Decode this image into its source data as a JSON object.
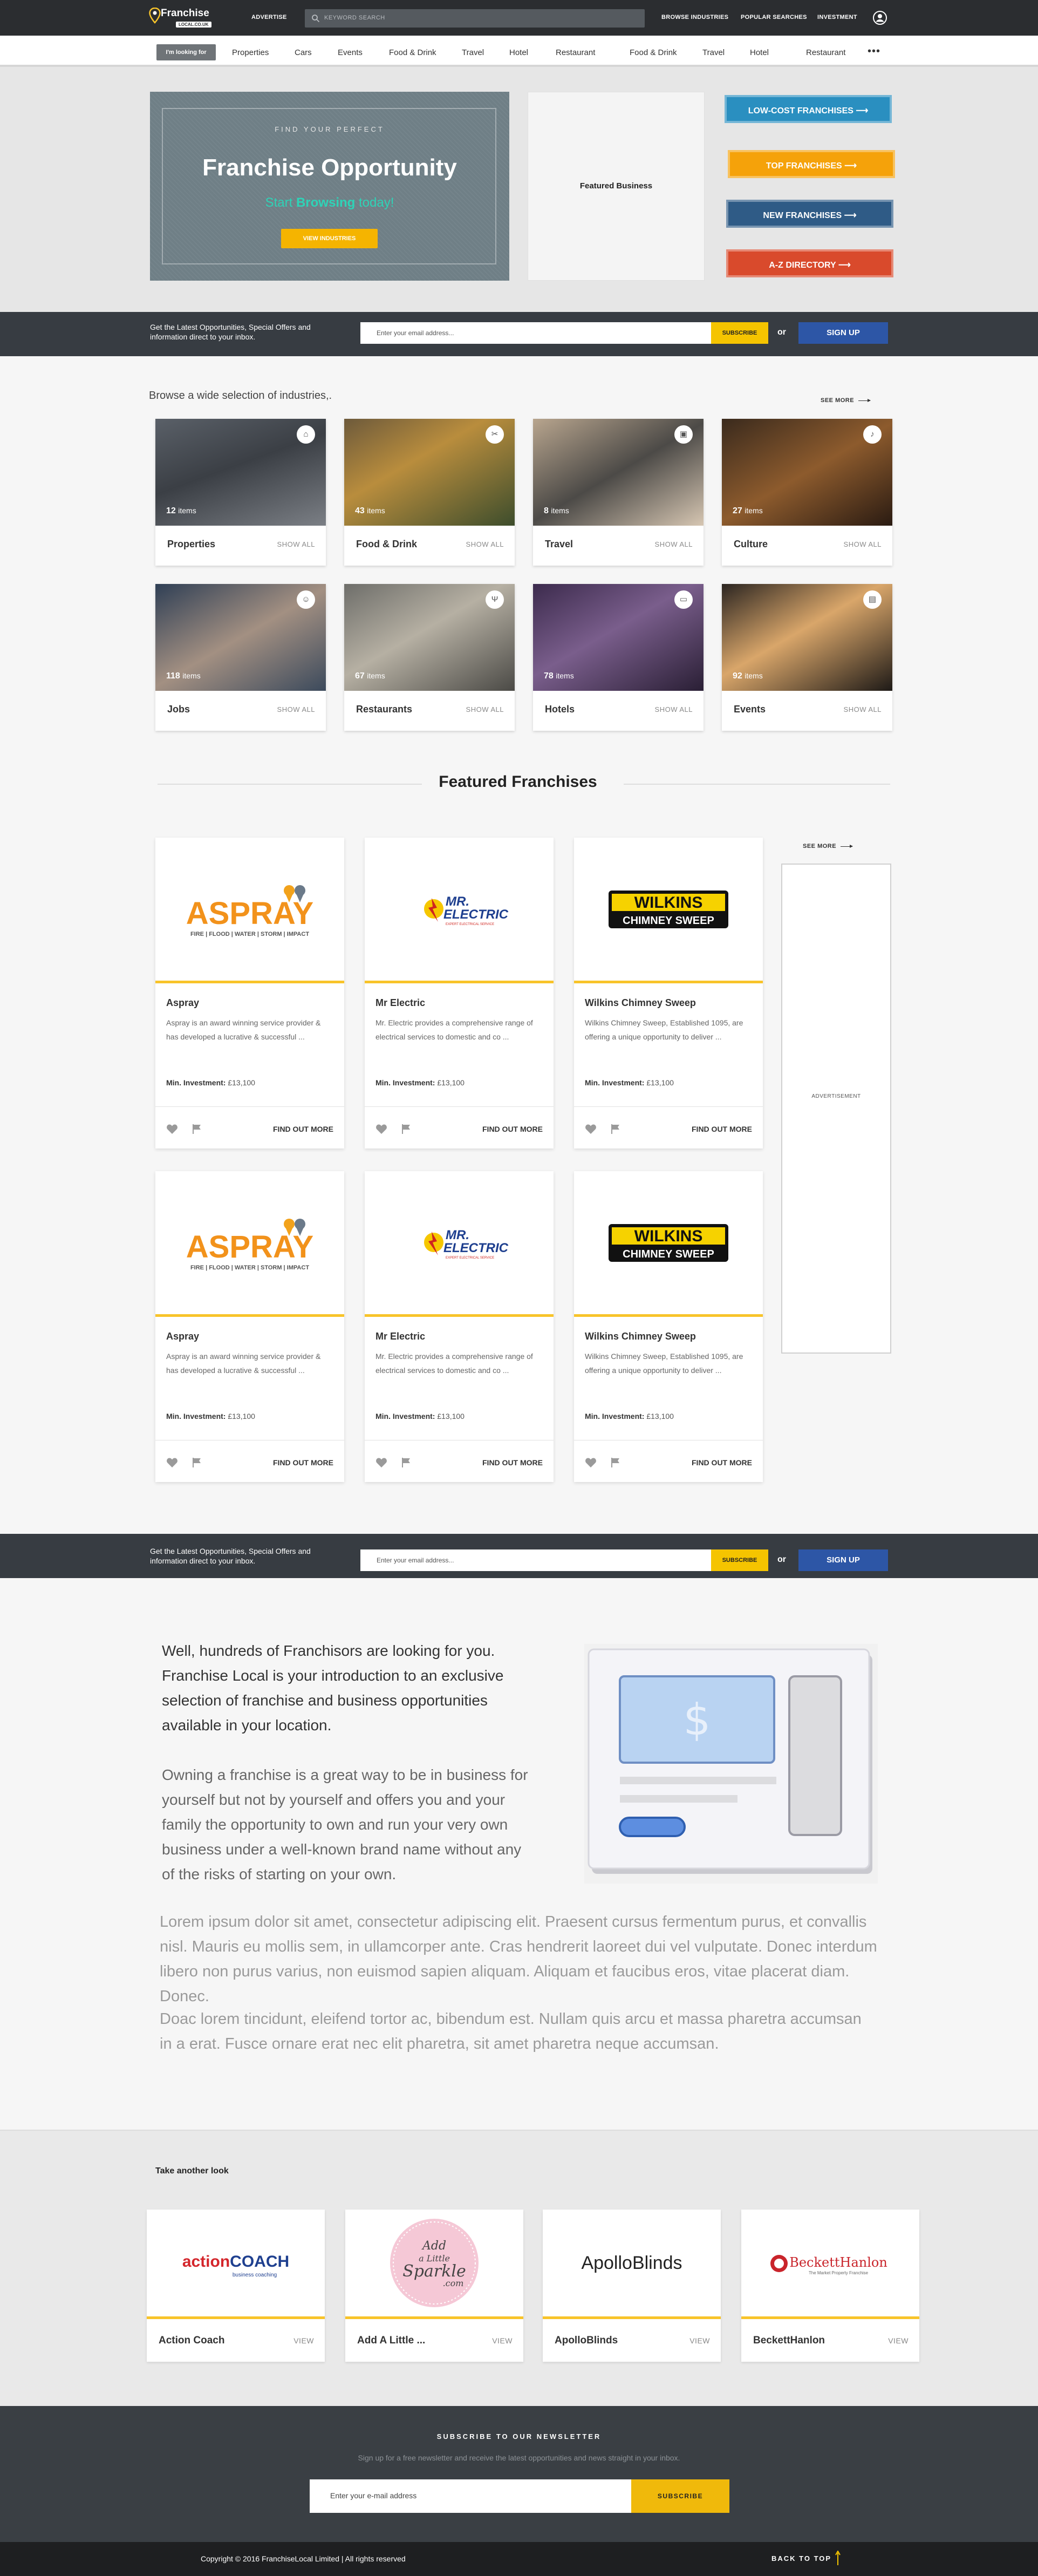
{
  "header": {
    "logo_title": "Franchise",
    "logo_sub": "LOCAL.CO.UK",
    "nav": [
      "ADVERTISE",
      "BROWSE INDUSTRIES",
      "POPULAR SEARCHES",
      "INVESTMENT"
    ],
    "search_placeholder": "KEYWORD SEARCH"
  },
  "category_bar": {
    "label": "I'm looking for",
    "items": [
      "Properties",
      "Cars",
      "Events",
      "Food & Drink",
      "Travel",
      "Hotel",
      "Restaurant",
      "Food & Drink",
      "Travel",
      "Hotel",
      "Restaurant"
    ],
    "more": "•••"
  },
  "hero": {
    "tagline": "FIND YOUR PERFECT",
    "title": "Franchise Opportunity",
    "sub_pre": "Start",
    "sub_bold": "Browsing",
    "sub_post": "today!",
    "button": "VIEW INDUSTRIES",
    "featured_label": "Featured Business",
    "cta": [
      {
        "label": "LOW-COST FRANCHISES",
        "color": "#2a8fc0"
      },
      {
        "label": "TOP FRANCHISES",
        "color": "#f5a20a"
      },
      {
        "label": "NEW FRANCHISES",
        "color": "#2f5b86"
      },
      {
        "label": "A-Z DIRECTORY",
        "color": "#d94a2c"
      }
    ]
  },
  "newsletter_strip": {
    "text": "Get the Latest Opportunities, Special Offers and information direct to your inbox.",
    "placeholder": "Enter your email address...",
    "subscribe": "SUBSCRIBE",
    "or": "or",
    "signup": "SIGN UP"
  },
  "industries": {
    "title": "Browse a wide selection of industries,.",
    "see_more": "SEE MORE",
    "show_all": "SHOW ALL",
    "items_word": "items",
    "list": [
      {
        "name": "Properties",
        "count": "12",
        "icon": "home-icon"
      },
      {
        "name": "Food & Drink",
        "count": "43",
        "icon": "cutlery-icon"
      },
      {
        "name": "Travel",
        "count": "8",
        "icon": "bus-icon"
      },
      {
        "name": "Culture",
        "count": "27",
        "icon": "music-icon"
      },
      {
        "name": "Jobs",
        "count": "118",
        "icon": "people-icon"
      },
      {
        "name": "Restaurants",
        "count": "67",
        "icon": "fork-knife-icon"
      },
      {
        "name": "Hotels",
        "count": "78",
        "icon": "bed-icon"
      },
      {
        "name": "Events",
        "count": "92",
        "icon": "ticket-icon"
      }
    ]
  },
  "featured": {
    "title": "Featured Franchises",
    "see_more": "SEE MORE",
    "find_out_more": "FIND OUT MORE",
    "investment_label": "Min. Investment:",
    "advertisement": "ADVERTISEMENT",
    "cards": [
      {
        "name": "Aspray",
        "desc": "Aspray is an award winning service provider & has developed a lucrative & successful ...",
        "investment": "£13,100",
        "logo": "aspray"
      },
      {
        "name": "Mr Electric",
        "desc": "Mr. Electric provides a comprehensive range of electrical services to domestic and co ...",
        "investment": "£13,100",
        "logo": "mrelectric"
      },
      {
        "name": "Wilkins Chimney Sweep",
        "desc": "Wilkins Chimney Sweep, Established 1095, are offering a unique opportunity to deliver ...",
        "investment": "£13,100",
        "logo": "wilkins"
      },
      {
        "name": "Aspray",
        "desc": "Aspray is an award winning service provider & has developed a lucrative & successful ...",
        "investment": "£13,100",
        "logo": "aspray"
      },
      {
        "name": "Mr Electric",
        "desc": "Mr. Electric provides a comprehensive range of electrical services to domestic and co ...",
        "investment": "£13,100",
        "logo": "mrelectric"
      },
      {
        "name": "Wilkins Chimney Sweep",
        "desc": "Wilkins Chimney Sweep, Established 1095, are offering a unique opportunity to deliver ...",
        "investment": "£13,100",
        "logo": "wilkins"
      }
    ],
    "logo_text": {
      "aspray": "ASPRAY",
      "aspray_tag": "FIRE | FLOOD | WATER | STORM | IMPACT",
      "mr": "MR.",
      "electric": "ELECTRIC",
      "mr_tag": "EXPERT ELECTRICAL SERVICE",
      "wilkins": "WILKINS",
      "wilkins_sub": "CHIMNEY SWEEP"
    }
  },
  "about": {
    "p1": "Well, hundreds of Franchisors are looking for you. Franchise Local is your introduction to an exclusive selection of franchise and business opportunities available in your location.",
    "p2": "Owning a franchise is a great way to be in business for yourself but not by yourself and offers you and your family the opportunity to own and run your very own business under a well-known brand name without any of the risks of starting on your own.",
    "p3": "Lorem ipsum dolor sit amet, consectetur adipiscing elit. Praesent cursus fermentum purus, et convallis nisl. Mauris eu mollis sem, in ullamcorper ante. Cras hendrerit laoreet dui vel vulputate.  Donec interdum libero non purus varius, non euismod sapien aliquam. Aliquam et faucibus eros, vitae placerat diam. Donec.",
    "p4": "Doac lorem tincidunt, eleifend tortor ac, bibendum est. Nullam quis arcu et massa pharetra accumsan in a erat. Fusce ornare erat nec elit pharetra, sit amet pharetra neque accumsan."
  },
  "another": {
    "title": "Take another look",
    "view": "VIEW",
    "cards": [
      {
        "name": "Action Coach",
        "logo_a": "action",
        "logo_b": "COACH",
        "tag": "business coaching"
      },
      {
        "name": "Add A Little ...",
        "logo_a": "Add",
        "logo_b": "a Little",
        "logo_c": "Sparkle",
        "tag": ".com"
      },
      {
        "name": "ApolloBlinds",
        "logo_a": "ApolloBlinds"
      },
      {
        "name": "BeckettHanlon",
        "logo_a": "BeckettHanlon",
        "tag": "The Market Property Franchise"
      }
    ]
  },
  "footer": {
    "title": "SUBSCRIBE TO OUR NEWSLETTER",
    "subtitle": "Sign up for a free newsletter and receive the latest opportunities and news straight in your inbox.",
    "placeholder": "Enter your e-mail address",
    "button": "SUBSCRIBE",
    "copyright": "Copyright © 2016 FranchiseLocal Limited | All rights reserved",
    "back_to_top": "BACK TO TOP"
  },
  "colors": {
    "accent": "#f8c42a",
    "dark": "#373c42",
    "signup": "#2d56a6"
  }
}
